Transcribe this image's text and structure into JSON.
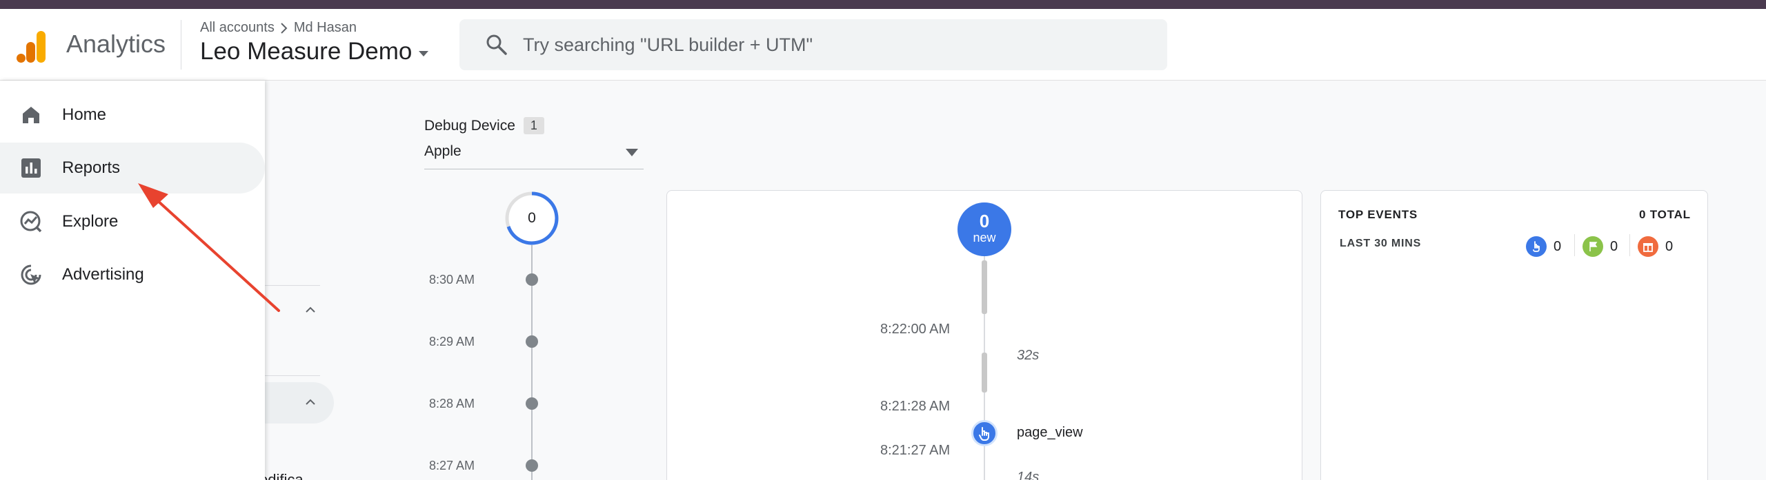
{
  "header": {
    "brand": "Analytics",
    "breadcrumb_root": "All accounts",
    "breadcrumb_account": "Md Hasan",
    "property_name": "Leo Measure Demo",
    "search_placeholder": "Try searching \"URL builder + UTM\""
  },
  "sidebar": {
    "items": [
      {
        "label": "Home",
        "icon": "home-icon"
      },
      {
        "label": "Reports",
        "icon": "reports-icon"
      },
      {
        "label": "Explore",
        "icon": "explore-icon"
      },
      {
        "label": "Advertising",
        "icon": "advertising-icon"
      }
    ],
    "active": "Reports"
  },
  "background": {
    "truncated_text": "odifica"
  },
  "debug": {
    "label": "Debug Device",
    "count": "1",
    "selected_device": "Apple"
  },
  "minutes": {
    "current_count": "0",
    "labels": [
      "8:30 AM",
      "8:29 AM",
      "8:28 AM",
      "8:27 AM"
    ]
  },
  "seconds": {
    "new_count": "0",
    "new_label": "new",
    "times": [
      "8:22:00 AM",
      "8:21:28 AM",
      "8:21:27 AM"
    ],
    "gaps": [
      "32s",
      "14s"
    ],
    "event_name": "page_view"
  },
  "top_events": {
    "title": "TOP EVENTS",
    "total": "0 TOTAL",
    "range": "LAST 30 MINS",
    "counts": [
      {
        "icon": "touch-icon",
        "color": "#3b78e7",
        "value": "0"
      },
      {
        "icon": "flag-icon",
        "color": "#8bc34a",
        "value": "0"
      },
      {
        "icon": "gift-icon",
        "color": "#f06b3e",
        "value": "0"
      }
    ]
  },
  "colors": {
    "accent_blue": "#3b78e7",
    "annotation_red": "#e8432f",
    "logo_orange": "#f9ab00",
    "logo_dark_orange": "#e37400"
  }
}
